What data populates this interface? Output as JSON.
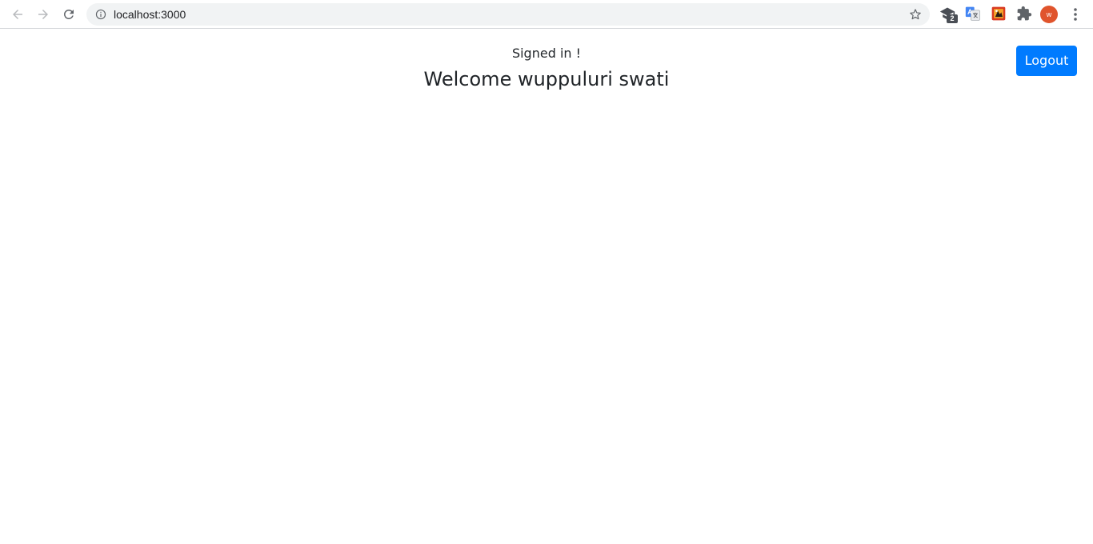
{
  "browser": {
    "url": "localhost:3000",
    "extension_badge_count": "2",
    "profile_initial": "w",
    "colors": {
      "toolbar_bg": "#ffffff",
      "omnibox_bg": "#f1f3f4",
      "icon_gray": "#5f6368",
      "avatar_bg": "#e0542c"
    },
    "icons": [
      "back-arrow-icon",
      "forward-arrow-icon",
      "reload-icon",
      "info-icon",
      "star-icon",
      "extension-graduation-cap-icon",
      "google-translate-icon",
      "extension-red-icon",
      "puzzle-piece-icon",
      "more-vertical-icon"
    ]
  },
  "page": {
    "status_text": "Signed in !",
    "welcome_text": "Welcome wuppuluri swati",
    "logout_label": "Logout",
    "colors": {
      "primary_button": "#007bff",
      "text": "#212529"
    }
  }
}
